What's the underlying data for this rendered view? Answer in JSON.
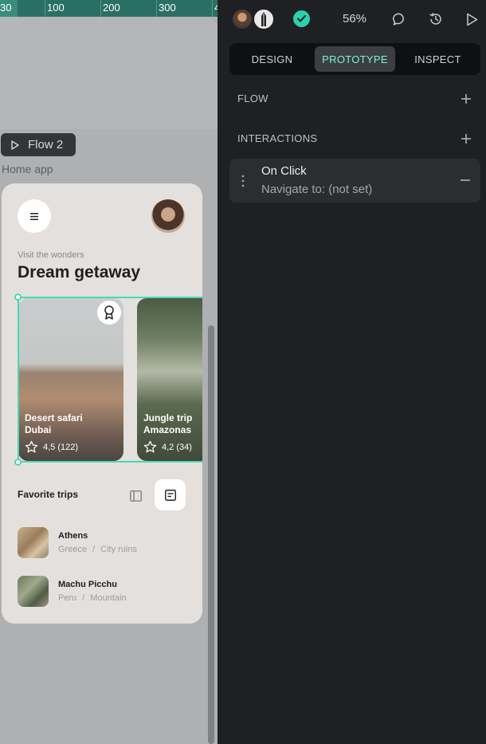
{
  "canvas": {
    "ruler": {
      "highlight": "30",
      "ticks": [
        "100",
        "200",
        "300",
        "4"
      ]
    },
    "flow_badge": {
      "label": "Flow 2",
      "icon": "play-outline-icon"
    },
    "board_label": "Home app",
    "phone": {
      "menu_icon": "hamburger-menu-icon",
      "subtitle": "Visit the wonders",
      "title": "Dream getaway",
      "cards": [
        {
          "name_line1": "Desert safari",
          "name_line2": "Dubai",
          "rating": "4,5 (122)",
          "badge_icon": "award-ribbon-icon"
        },
        {
          "name_line1": "Jungle trip",
          "name_line2": "Amazonas",
          "rating": "4,2 (34)"
        }
      ],
      "favorites_title": "Favorite trips",
      "trips": [
        {
          "name": "Athens",
          "country": "Greece",
          "sep": "/",
          "category": "City ruins"
        },
        {
          "name": "Machu Picchu",
          "country": "Peru",
          "sep": "/",
          "category": "Mountain"
        }
      ]
    }
  },
  "panel": {
    "zoom": "56%",
    "icons": [
      "comment-icon",
      "history-icon",
      "play-icon",
      "saved-check-icon"
    ],
    "tabs": [
      {
        "label": "DESIGN",
        "active": false
      },
      {
        "label": "PROTOTYPE",
        "active": true
      },
      {
        "label": "INSPECT",
        "active": false
      }
    ],
    "sections": {
      "flow": "FLOW",
      "interactions": "INTERACTIONS"
    },
    "interaction": {
      "title": "On Click",
      "description": "Navigate to: (not set)"
    }
  },
  "colors": {
    "accent": "#2ccfae",
    "active_tab_text": "#7ff2d8",
    "selection": "#47d9b3",
    "panel_bg": "#1f2023",
    "canvas_bg": "#aeb0b2"
  }
}
